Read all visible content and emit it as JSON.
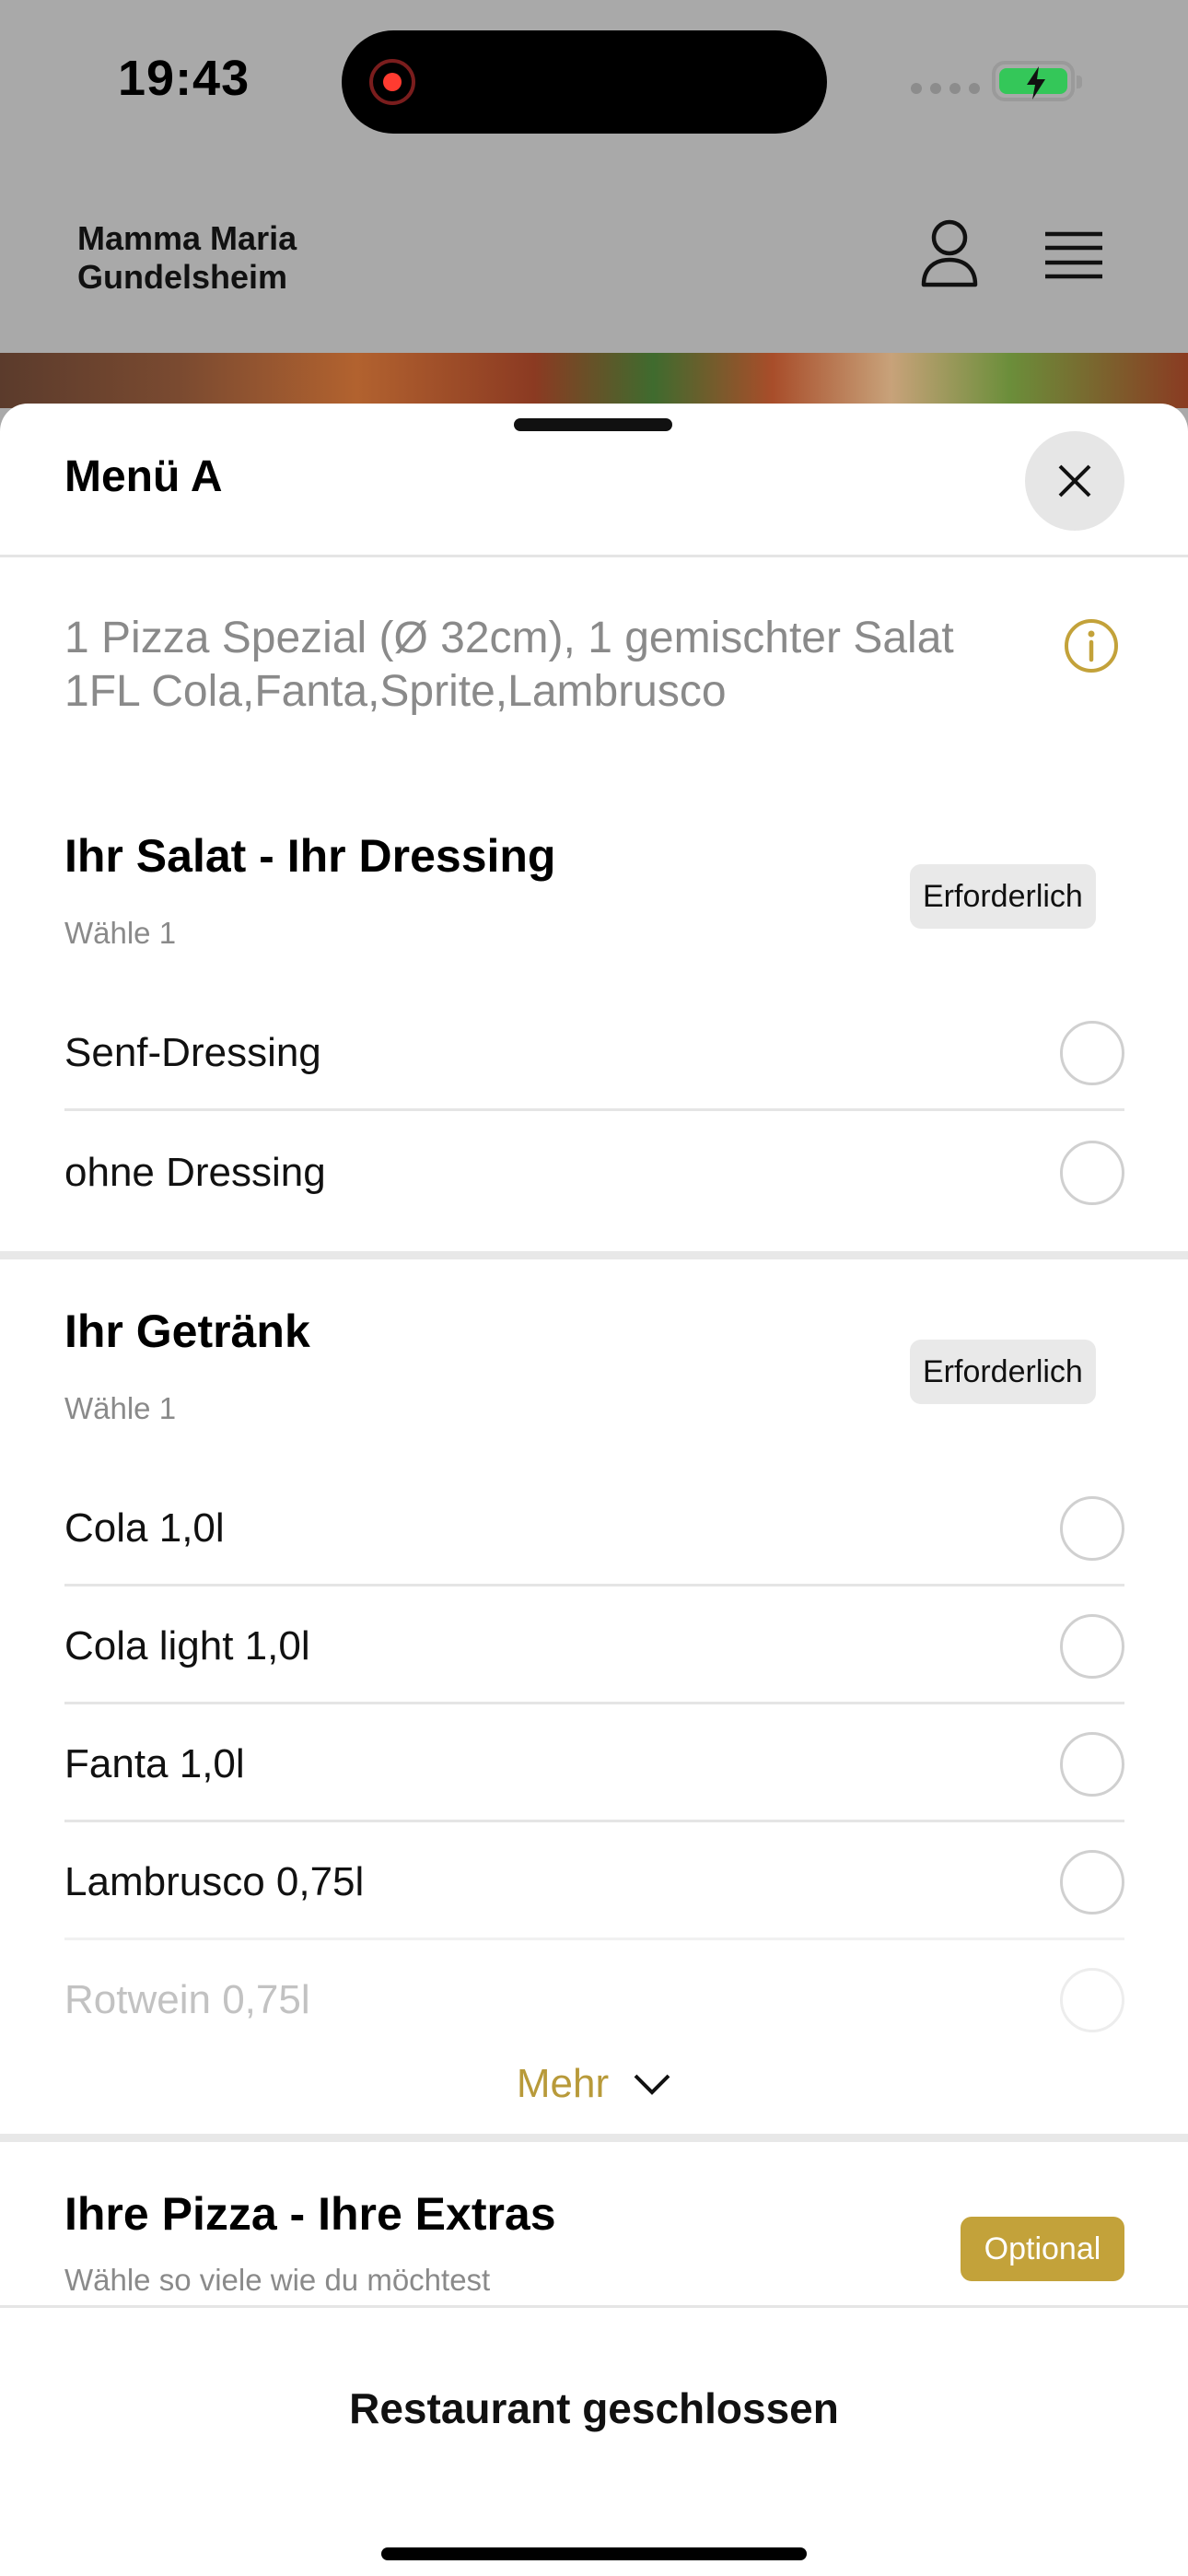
{
  "status_bar": {
    "time": "19:43"
  },
  "app_header": {
    "brand_line1": "Mamma Maria",
    "brand_line2": "Gundelsheim"
  },
  "sheet": {
    "title": "Menü A",
    "description_line1": "1 Pizza Spezial (Ø 32cm), 1 gemischter Salat",
    "description_line2": "1FL Cola,Fanta,Sprite,Lambrusco"
  },
  "groups": [
    {
      "title": "Ihr Salat - Ihr Dressing",
      "subtitle": "Wähle 1",
      "badge": "Erforderlich",
      "options": [
        "Senf-Dressing",
        "ohne Dressing"
      ]
    },
    {
      "title": "Ihr Getränk",
      "subtitle": "Wähle 1",
      "badge": "Erforderlich",
      "options": [
        "Cola 1,0l",
        "Cola light 1,0l",
        "Fanta 1,0l",
        "Lambrusco 0,75l",
        "Rotwein 0,75l"
      ],
      "more_label": "Mehr"
    },
    {
      "title": "Ihre Pizza - Ihre Extras",
      "subtitle": "Wähle so viele wie du möchtest",
      "badge": "Optional"
    }
  ],
  "footer": {
    "status": "Restaurant geschlossen"
  },
  "colors": {
    "accent_gold": "#c3a23a",
    "battery_green": "#34c759",
    "record_red": "#ff3b30"
  },
  "icons": [
    "user-icon",
    "hamburger-menu-icon",
    "close-icon",
    "info-icon",
    "chevron-down-icon"
  ]
}
